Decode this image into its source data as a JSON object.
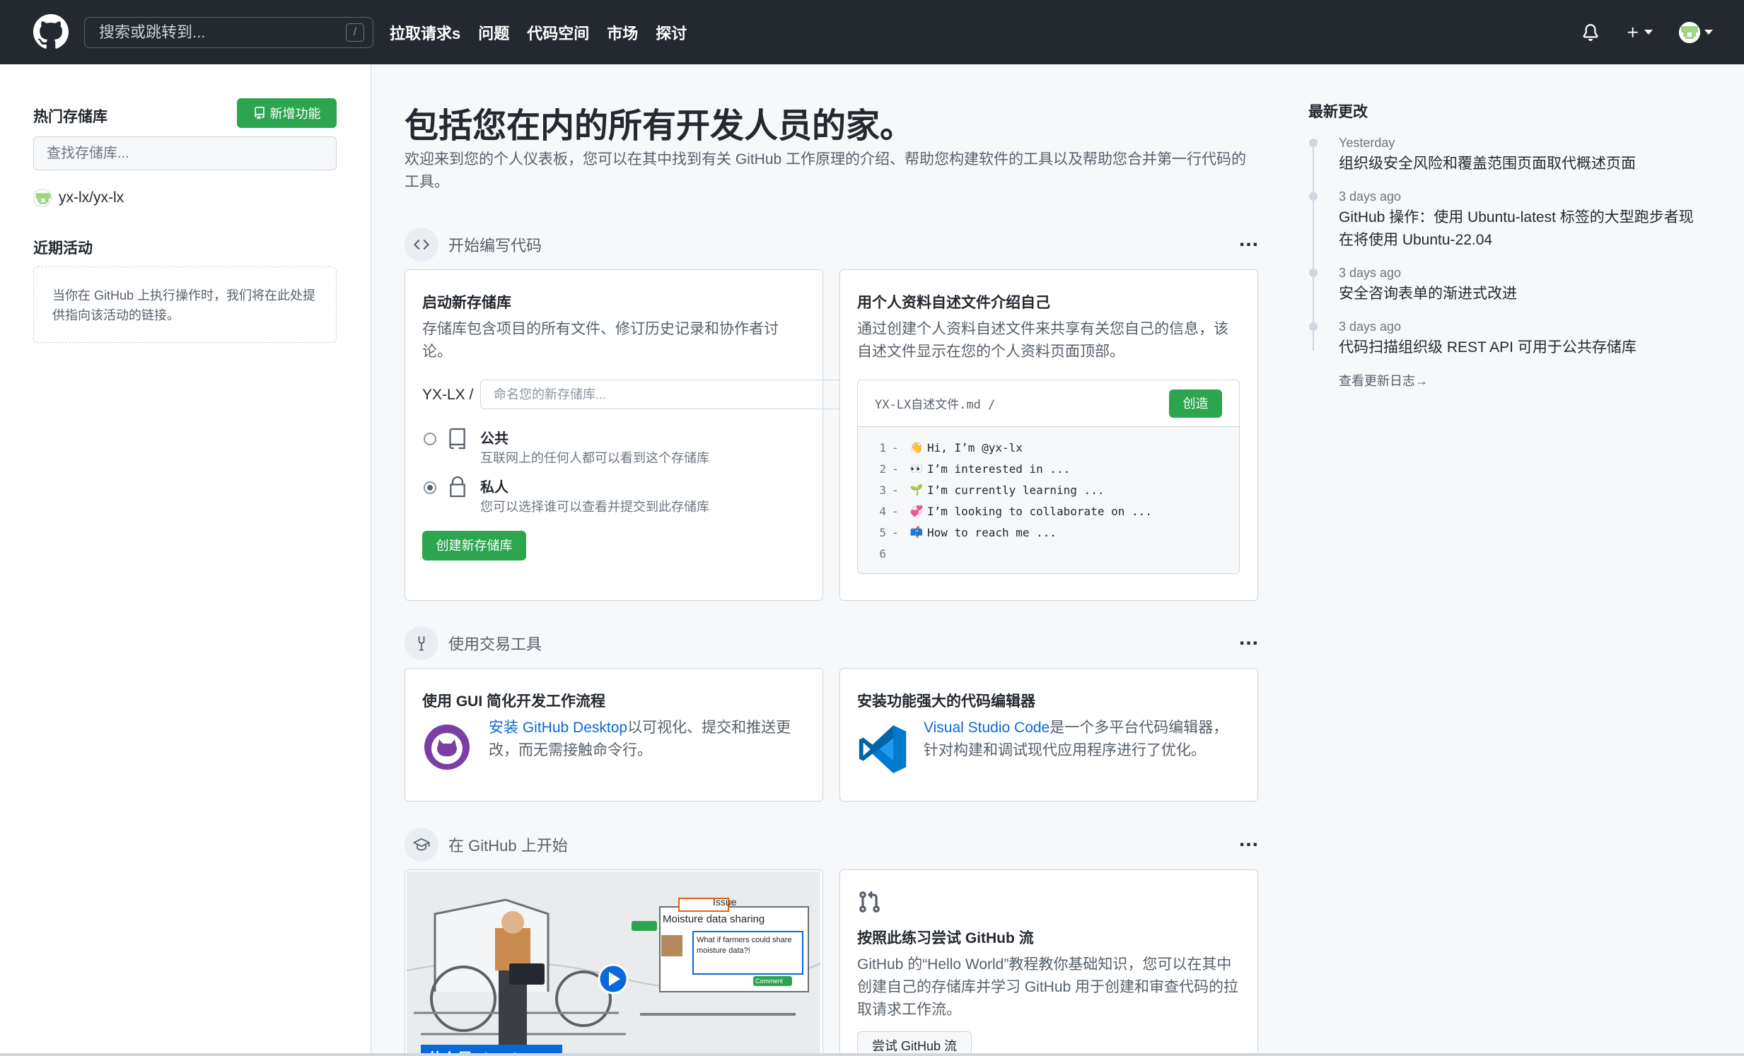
{
  "header": {
    "search_placeholder": "搜索或跳转到...",
    "search_shortcut": "/",
    "nav": [
      "拉取请求s",
      "问题",
      "代码空间",
      "市场",
      "探讨"
    ]
  },
  "sidebar": {
    "top_repos_title": "热门存储库",
    "new_button": "新增功能",
    "find_repo_placeholder": "查找存储库...",
    "repos": [
      "yx-lx/yx-lx"
    ],
    "recent_activity_title": "近期活动",
    "recent_activity_empty": "当你在 GitHub 上执行操作时，我们将在此处提供指向该活动的链接。"
  },
  "main": {
    "title": "包括您在内的所有开发人员的家。",
    "description": "欢迎来到您的个人仪表板，您可以在其中找到有关 GitHub 工作原理的介绍、帮助您构建软件的工具以及帮助您合并第一行代码的工具。",
    "sections": [
      {
        "title": "开始编写代码",
        "menu": "..."
      },
      {
        "title": "使用交易工具",
        "menu": "..."
      },
      {
        "title": "在 GitHub 上开始",
        "menu": "..."
      }
    ],
    "new_repo_card": {
      "title": "启动新存储库",
      "text": "存储库包含项目的所有文件、修订历史记录和协作者讨论。",
      "owner": "YX-LX /",
      "name_placeholder": "命名您的新存储库...",
      "public_label": "公共",
      "public_desc": "互联网上的任何人都可以看到这个存储库",
      "private_label": "私人",
      "private_desc": "您可以选择谁可以查看并提交到此存储库",
      "create_button": "创建新存储库"
    },
    "readme_card": {
      "title": "用个人资料自述文件介绍自己",
      "text": "通过创建个人资料自述文件来共享有关您自己的信息，该自述文件显示在您的个人资料页面顶部。",
      "path": "YX-LX自述文件.md /",
      "create_button": "创造",
      "lines": [
        {
          "n": "1",
          "dash": "-",
          "emoji": "👋",
          "text": "Hi, I’m @yx-lx"
        },
        {
          "n": "2",
          "dash": "-",
          "emoji": "👀",
          "text": "I’m interested in ..."
        },
        {
          "n": "3",
          "dash": "-",
          "emoji": "🌱",
          "text": "I’m currently learning ..."
        },
        {
          "n": "4",
          "dash": "-",
          "emoji": "💞",
          "text": "I’m looking to collaborate on ..."
        },
        {
          "n": "5",
          "dash": "-",
          "emoji": "📫",
          "text": "How to reach me ..."
        },
        {
          "n": "6",
          "dash": "",
          "emoji": "",
          "text": ""
        }
      ]
    },
    "desktop_card": {
      "title": "使用 GUI 简化开发工作流程",
      "link": "安装 GitHub Desktop",
      "text": "以可视化、提交和推送更改，而无需接触命令行。"
    },
    "vscode_card": {
      "title": "安装功能强大的代码编辑器",
      "link": "Visual Studio Code",
      "text": "是一个多平台代码编辑器，针对构建和调试现代应用程序进行了优化。"
    },
    "video_card": {
      "issue_tab": "Issue",
      "issue_title": "Moisture data sharing",
      "issue_comment": "What if farmers could share moisture data?!",
      "comment_button": "Comment",
      "caption": "什么是GitHub?"
    },
    "flow_card": {
      "title": "按照此练习尝试 GitHub 流",
      "text": "GitHub 的“Hello World”教程教你基础知识，您可以在其中创建自己的存储库并学习 GitHub 用于创建和审查代码的拉取请求工作流。",
      "button": "尝试 GitHub 流"
    }
  },
  "changes": {
    "title": "最新更改",
    "items": [
      {
        "date": "Yesterday",
        "text": "组织级安全风险和覆盖范围页面取代概述页面"
      },
      {
        "date": "3 days ago",
        "text": "GitHub 操作：使用 Ubuntu-latest 标签的大型跑步者现在将使用 Ubuntu-22.04"
      },
      {
        "date": "3 days ago",
        "text": "安全咨询表单的渐进式改进"
      },
      {
        "date": "3 days ago",
        "text": "代码扫描组织级 REST API 可用于公共存储库"
      }
    ],
    "changelog_link": "查看更新日志→"
  }
}
